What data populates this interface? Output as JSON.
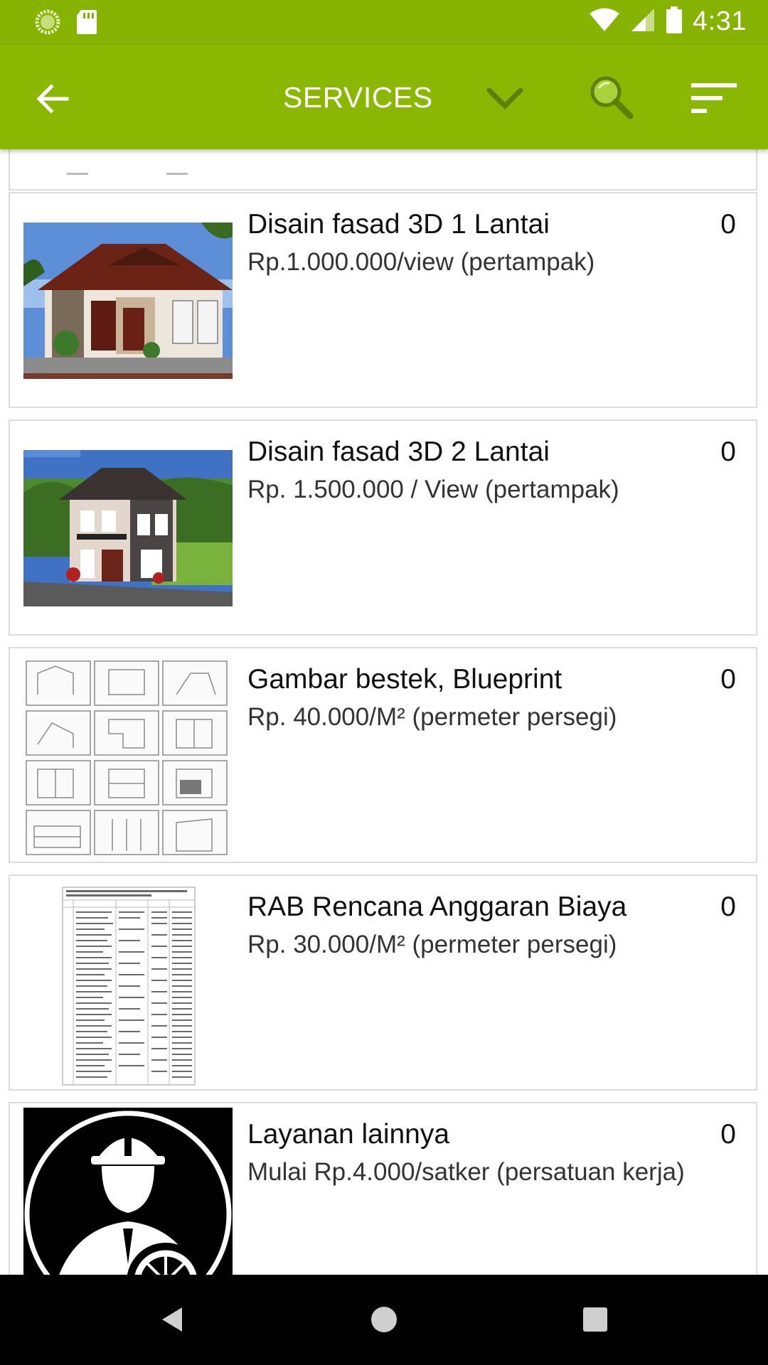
{
  "status_bar": {
    "time": "4:31"
  },
  "app_bar": {
    "title": "SERVICES"
  },
  "services": [
    {
      "name": "Disain fasad 3D 1 Lantai",
      "price": "Rp.1.000.000/view (pertampak)",
      "count": "0",
      "thumbnail": "house-one-storey-render"
    },
    {
      "name": "Disain fasad 3D 2 Lantai",
      "price": "Rp. 1.500.000 / View (pertampak)",
      "count": "0",
      "thumbnail": "house-two-storey-render"
    },
    {
      "name": "Gambar bestek, Blueprint",
      "price": "Rp. 40.000/M² (permeter persegi)",
      "count": "0",
      "thumbnail": "blueprint-sheets"
    },
    {
      "name": "RAB Rencana Anggaran Biaya",
      "price": "Rp. 30.000/M² (permeter persegi)",
      "count": "0",
      "thumbnail": "budget-spreadsheet"
    },
    {
      "name": "Layanan lainnya",
      "price": "Mulai Rp.4.000/satker (persatuan kerja)",
      "count": "0",
      "thumbnail": "engineer-gear-icon"
    }
  ],
  "colors": {
    "status_bar": "#86b201",
    "app_bar": "#8ab802",
    "nav_bar": "#000000"
  }
}
